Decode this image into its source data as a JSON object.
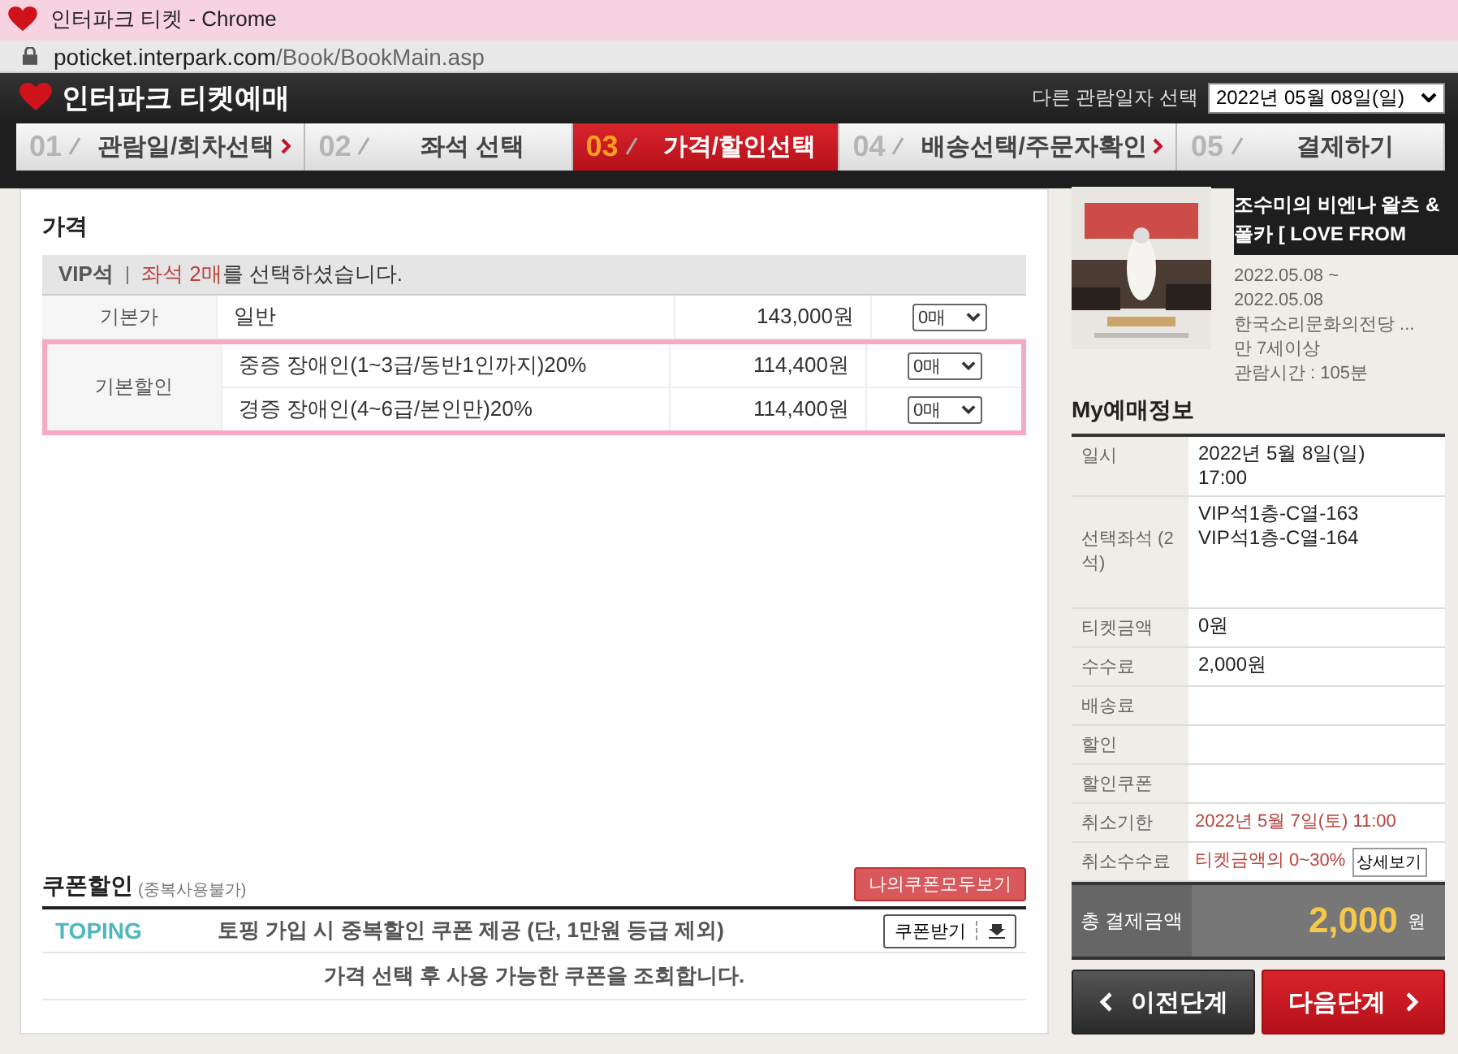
{
  "browser": {
    "title": "인터파크 티켓 - Chrome",
    "url_host": "poticket.interpark.com",
    "url_path": "/Book/BookMain.asp"
  },
  "header": {
    "brand": "인터파크 티켓예매",
    "date_label": "다른 관람일자 선택",
    "date_value": "2022년 05월 08일(일)"
  },
  "steps": [
    {
      "number": "01",
      "label": "관람일/회차선택",
      "selected": false
    },
    {
      "number": "02",
      "label": "좌석 선택",
      "selected": false
    },
    {
      "number": "03",
      "label": "가격/할인선택",
      "selected": true
    },
    {
      "number": "04",
      "label": "배송선택/주문자확인",
      "selected": false
    },
    {
      "number": "05",
      "label": "결제하기",
      "selected": false
    }
  ],
  "price": {
    "title": "가격",
    "seat_grade": "VIP석",
    "note_highlight": "좌석 2매",
    "note_rest": "를 선택하셨습니다.",
    "groups": [
      {
        "label": "기본가",
        "highlighted": false,
        "items": [
          {
            "name": "일반",
            "price": "143,000원",
            "quantity": "0매"
          }
        ]
      },
      {
        "label": "기본할인",
        "highlighted": true,
        "items": [
          {
            "name": "중증 장애인(1~3급/동반1인까지)20%",
            "price": "114,400원",
            "quantity": "0매"
          },
          {
            "name": "경증 장애인(4~6급/본인만)20%",
            "price": "114,400원",
            "quantity": "0매"
          }
        ]
      }
    ]
  },
  "coupon": {
    "title": "쿠폰할인",
    "note": "(중복사용불가)",
    "view_all": "나의쿠폰모두보기",
    "provider": "TOPING",
    "offer": "토핑 가입 시 중복할인 쿠폰 제공 (단, 1만원 등급 제외)",
    "get_button": "쿠폰받기",
    "message": "가격 선택 후 사용 가능한 쿠폰을 조회합니다."
  },
  "show": {
    "title": "조수미의 비엔나 왈츠 & 폴카 [ LOVE FROM",
    "details": [
      "2022.05.08 ~",
      "2022.05.08",
      "한국소리문화의전당 ...",
      "만 7세이상",
      "관람시간 : 105분"
    ]
  },
  "booking": {
    "title": "My예매정보",
    "rows": [
      {
        "label": "일시",
        "kind": "plain",
        "values": [
          "2022년 5월 8일(일)",
          "17:00"
        ]
      },
      {
        "label": "선택좌석 (2석)",
        "kind": "seats",
        "values": [
          "VIP석1층-C열-163",
          "VIP석1층-C열-164"
        ]
      },
      {
        "label": "티켓금액",
        "kind": "plain",
        "values": [
          "0원"
        ]
      },
      {
        "label": "수수료",
        "kind": "plain",
        "values": [
          "2,000원"
        ]
      },
      {
        "label": "배송료",
        "kind": "plain",
        "values": []
      },
      {
        "label": "할인",
        "kind": "plain",
        "values": []
      },
      {
        "label": "할인쿠폰",
        "kind": "plain",
        "values": []
      },
      {
        "label": "취소기한",
        "kind": "notice",
        "values": [
          "2022년 5월 7일(토) 11:00"
        ]
      },
      {
        "label": "취소수수료",
        "kind": "notice",
        "values": [
          "티켓금액의 0~30%"
        ],
        "button": "상세보기"
      }
    ],
    "total_label": "총 결제금액",
    "total_amount": "2,000",
    "total_unit": "원"
  },
  "buttons": {
    "prev": "이전단계",
    "next": "다음단계"
  }
}
